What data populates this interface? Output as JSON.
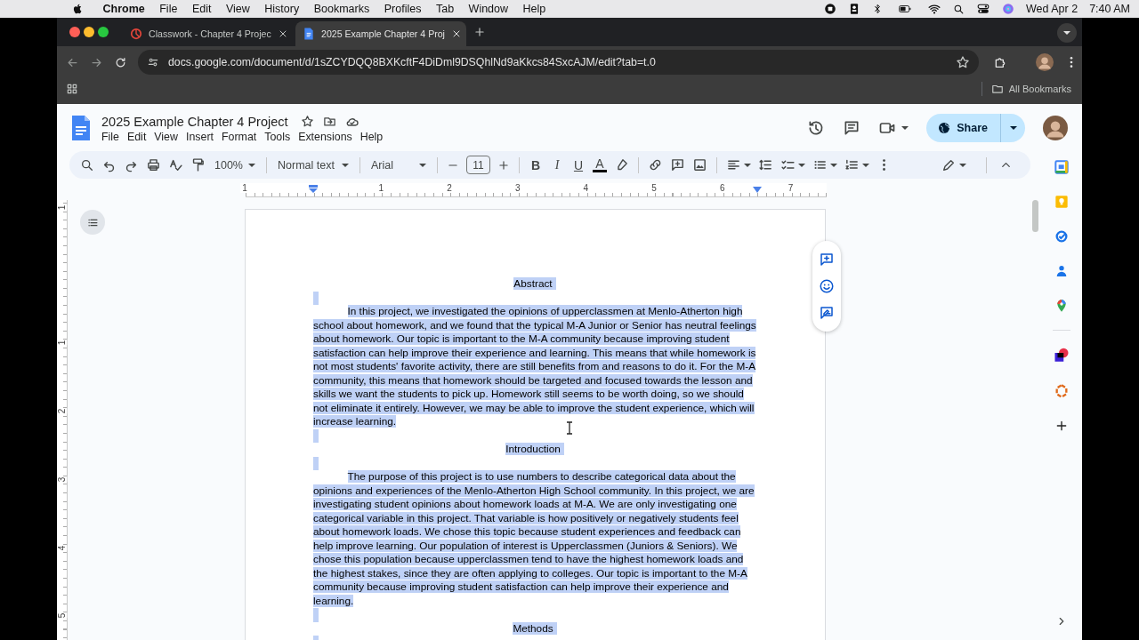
{
  "menubar": {
    "app": "Chrome",
    "menus": [
      "File",
      "Edit",
      "View",
      "History",
      "Bookmarks",
      "Profiles",
      "Tab",
      "Window",
      "Help"
    ],
    "date": "Wed Apr 2",
    "time": "7:40 AM"
  },
  "browser": {
    "tabs": [
      {
        "title": "Classwork - Chapter 4 Projec",
        "selected": false
      },
      {
        "title": "2025 Example Chapter 4 Proj",
        "selected": true
      }
    ],
    "url": "docs.google.com/document/d/1sZCYDQQ8BXKcftF4DiDml9DSQhlNd9aKkcs84SxcAJM/edit?tab=t.0",
    "bookmarks_label": "All Bookmarks"
  },
  "docs": {
    "title": "2025 Example Chapter 4 Project",
    "menus": [
      "File",
      "Edit",
      "View",
      "Insert",
      "Format",
      "Tools",
      "Extensions",
      "Help"
    ],
    "share": "Share",
    "toolbar": {
      "zoom": "100%",
      "style": "Normal text",
      "font": "Arial",
      "font_size": "11",
      "bold": "B",
      "italic": "I",
      "underline": "U",
      "text_color": "A"
    },
    "ruler": {
      "labels": [
        "1",
        "1",
        "2",
        "3",
        "4",
        "5",
        "6",
        "7"
      ]
    },
    "vertical_ruler": {
      "labels": [
        "1",
        "1",
        "2",
        "3",
        "4",
        "5"
      ]
    },
    "document": {
      "text_selected": true,
      "blocks": [
        {
          "kind": "heading",
          "text": "Abstract"
        },
        {
          "kind": "blank"
        },
        {
          "kind": "paragraph",
          "lines": [
            "In this project, we investigated the opinions of upperclassmen at Menlo-Atherton high",
            "school about homework, and we found that the typical M-A Junior or Senior has neutral feelings",
            "about homework.  Our topic is important to the M-A community because improving student",
            "satisfaction can help improve their experience and learning.  This means that while homework is",
            "not most students' favorite activity, there are still benefits from and reasons to do it.  For the M-A",
            "community, this means that homework should be targeted and focused towards the lesson and",
            "skills we want the students to pick up.  Homework still seems to be worth doing, so we should",
            "not eliminate it entirely.  However, we may be able to improve the student experience, which will",
            "increase learning."
          ]
        },
        {
          "kind": "blank"
        },
        {
          "kind": "heading",
          "text": "Introduction"
        },
        {
          "kind": "blank"
        },
        {
          "kind": "paragraph",
          "lines": [
            "The purpose of this project is to use numbers to describe categorical data about the",
            "opinions and experiences of the Menlo-Atherton High School community.  In this project, we are",
            "investigating student opinions about homework loads at M-A.  We are only investigating one",
            "categorical variable in this project.  That variable is how positively or negatively students feel",
            "about homework loads.  We chose this topic because student experiences and feedback can",
            "help improve learning.  Our population of interest is Upperclassmen (Juniors & Seniors).  We",
            "chose this population because upperclassmen tend to have the highest homework loads and",
            "the highest stakes, since they are often applying to colleges.  Our topic is important to the M-A",
            "community because improving student satisfaction can help improve their experience and",
            "learning."
          ]
        },
        {
          "kind": "blank"
        },
        {
          "kind": "heading",
          "text": "Methods"
        },
        {
          "kind": "blank"
        }
      ]
    }
  }
}
